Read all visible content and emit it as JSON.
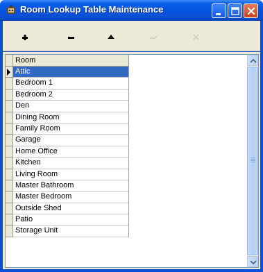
{
  "window": {
    "title": "Room Lookup Table Maintenance",
    "icons": {
      "app": "app-icon",
      "minimize": "minimize-icon",
      "maximize": "maximize-icon",
      "close": "close-icon"
    }
  },
  "toolbar": {
    "buttons": [
      {
        "name": "insert-record",
        "icon": "plus-icon",
        "enabled": true
      },
      {
        "name": "delete-record",
        "icon": "minus-icon",
        "enabled": true
      },
      {
        "name": "edit-record",
        "icon": "triangle-up-icon",
        "enabled": true
      },
      {
        "name": "post-edit",
        "icon": "check-icon",
        "enabled": false
      },
      {
        "name": "cancel-edit",
        "icon": "x-icon",
        "enabled": false
      }
    ]
  },
  "grid": {
    "header": "Room",
    "rows": [
      "Attic",
      "Bedroom 1",
      "Bedroom 2",
      "Den",
      "Dining Room",
      "Family Room",
      "Garage",
      "Home Office",
      "Kitchen",
      "Living Room",
      "Master Bathroom",
      "Master Bedroom",
      "Outside Shed",
      "Patio",
      "Storage Unit"
    ],
    "selected_index": 0,
    "colors": {
      "selection": "#316ac5",
      "header_bg": "#ece9d8"
    }
  },
  "colors": {
    "titlebar": "#0553df",
    "window_bg": "#ece9d8"
  }
}
